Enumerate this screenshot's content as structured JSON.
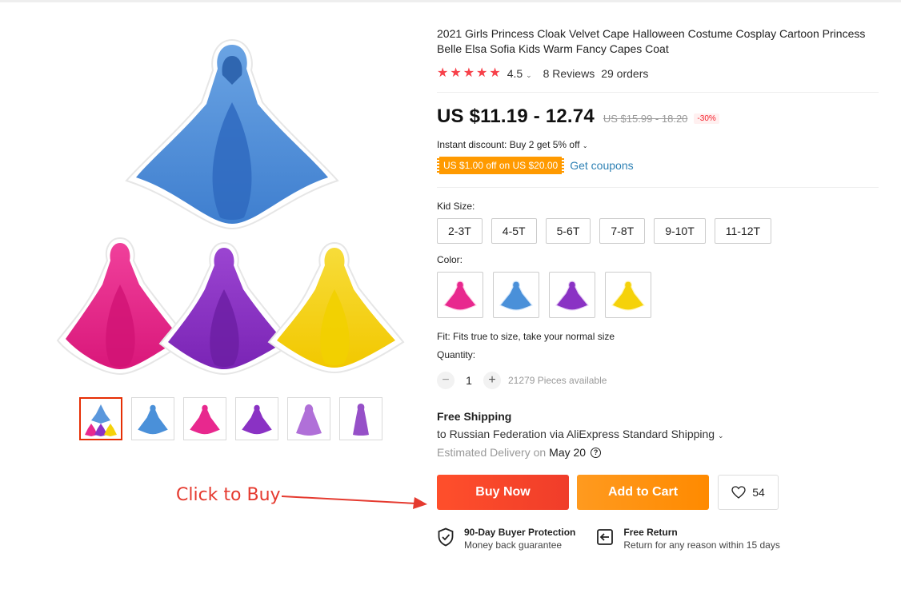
{
  "product": {
    "title": "2021 Girls Princess Cloak Velvet Cape Halloween Costume Cosplay Cartoon Princess Belle Elsa Sofia Kids Warm Fancy Capes Coat",
    "rating": "4.5",
    "reviews": "8 Reviews",
    "orders": "29 orders",
    "price_now": "US $11.19 - 12.74",
    "price_old": "US $15.99 - 18.20",
    "discount": "-30%",
    "instant_discount": "Instant discount: Buy 2 get 5% off",
    "coupon_tag": "US $1.00 off on US $20.00",
    "get_coupons": "Get coupons",
    "size_label": "Kid Size:",
    "sizes": [
      "2-3T",
      "4-5T",
      "5-6T",
      "7-8T",
      "9-10T",
      "11-12T"
    ],
    "color_label": "Color:",
    "colors": [
      {
        "name": "pink",
        "main": "#e8288e",
        "light": "#f56ab6"
      },
      {
        "name": "blue",
        "main": "#4a90d9",
        "light": "#86b9ea"
      },
      {
        "name": "purple",
        "main": "#8a32c4",
        "light": "#b47ae0"
      },
      {
        "name": "yellow",
        "main": "#f5d20a",
        "light": "#f7e57a"
      }
    ],
    "fit": "Fit: Fits true to size, take your normal size",
    "quantity_label": "Quantity:",
    "quantity_value": "1",
    "qty_minus": "−",
    "qty_plus": "+",
    "pieces_available": "21279 Pieces available"
  },
  "shipping": {
    "title": "Free Shipping",
    "to": "to Russian Federation via AliExpress Standard Shipping",
    "est_label": "Estimated Delivery on",
    "est_date": "May 20",
    "help": "?"
  },
  "actions": {
    "buy_now": "Buy Now",
    "add_to_cart": "Add to Cart",
    "wishlist_count": "54"
  },
  "guarantees": [
    {
      "title": "90-Day Buyer Protection",
      "sub": "Money back guarantee",
      "icon": "shield-check-icon"
    },
    {
      "title": "Free Return",
      "sub": "Return for any reason within 15 days",
      "icon": "return-icon"
    }
  ],
  "annotation": {
    "text": "Click to Buy",
    "color": "#e53a2f"
  },
  "gallery": {
    "thumbnails": [
      "multi",
      "blue",
      "pink",
      "purple",
      "lavender",
      "violet"
    ]
  }
}
